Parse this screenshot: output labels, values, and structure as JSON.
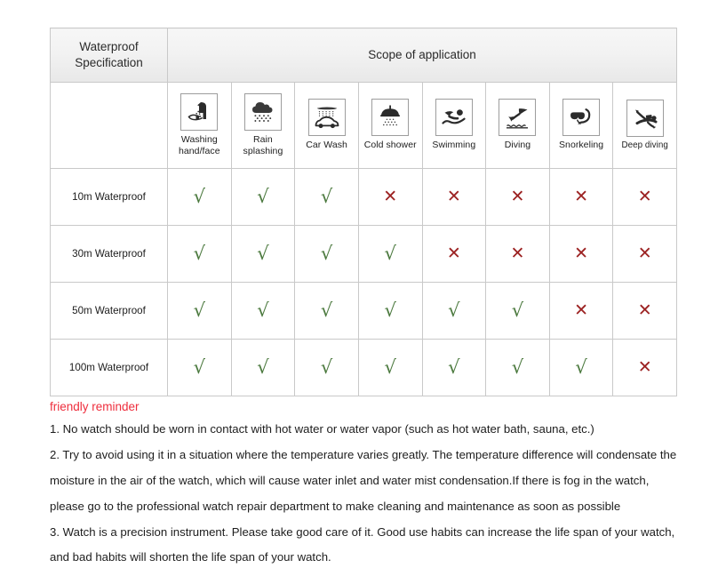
{
  "table": {
    "spec_header": "Waterproof Specification",
    "scope_header": "Scope of application",
    "columns": [
      {
        "icon": "washing-hand-face-icon",
        "label": "Washing hand/face"
      },
      {
        "icon": "rain-splashing-icon",
        "label": "Rain splashing"
      },
      {
        "icon": "car-wash-icon",
        "label": "Car Wash"
      },
      {
        "icon": "cold-shower-icon",
        "label": "Cold shower"
      },
      {
        "icon": "swimming-icon",
        "label": "Swimming"
      },
      {
        "icon": "diving-icon",
        "label": "Diving"
      },
      {
        "icon": "snorkeling-icon",
        "label": "Snorkeling"
      },
      {
        "icon": "deep-diving-icon",
        "label": "Deep diving"
      }
    ],
    "rows": [
      {
        "label": "10m Waterproof",
        "cells": [
          "yes",
          "yes",
          "yes",
          "no",
          "no",
          "no",
          "no",
          "no"
        ]
      },
      {
        "label": "30m Waterproof",
        "cells": [
          "yes",
          "yes",
          "yes",
          "yes",
          "no",
          "no",
          "no",
          "no"
        ]
      },
      {
        "label": "50m Waterproof",
        "cells": [
          "yes",
          "yes",
          "yes",
          "yes",
          "yes",
          "yes",
          "no",
          "no"
        ]
      },
      {
        "label": "100m Waterproof",
        "cells": [
          "yes",
          "yes",
          "yes",
          "yes",
          "yes",
          "yes",
          "yes",
          "no"
        ]
      }
    ],
    "marks": {
      "yes": "√",
      "no": "✕"
    },
    "colors": {
      "yes": "#4c7a3f",
      "no": "#9c2222",
      "border": "#c9c9c9",
      "header_bg": "#f0f0f0"
    }
  },
  "notes": {
    "title": "friendly reminder",
    "title_color": "#ee2d3c",
    "lines": [
      "1. No watch should be worn in contact with hot water or water vapor (such as hot water bath, sauna, etc.)",
      "2. Try to avoid using it in a situation where the temperature varies greatly. The temperature difference will condensate the",
      "moisture in the air of the watch, which will cause water inlet and water mist condensation.If there is fog in the watch,",
      "please go to the professional watch repair department to make cleaning and maintenance as soon as possible",
      "3. Watch is a precision instrument. Please take good care of it. Good use habits can increase the life span of your watch,",
      "and bad habits will shorten the life span of your watch."
    ]
  }
}
